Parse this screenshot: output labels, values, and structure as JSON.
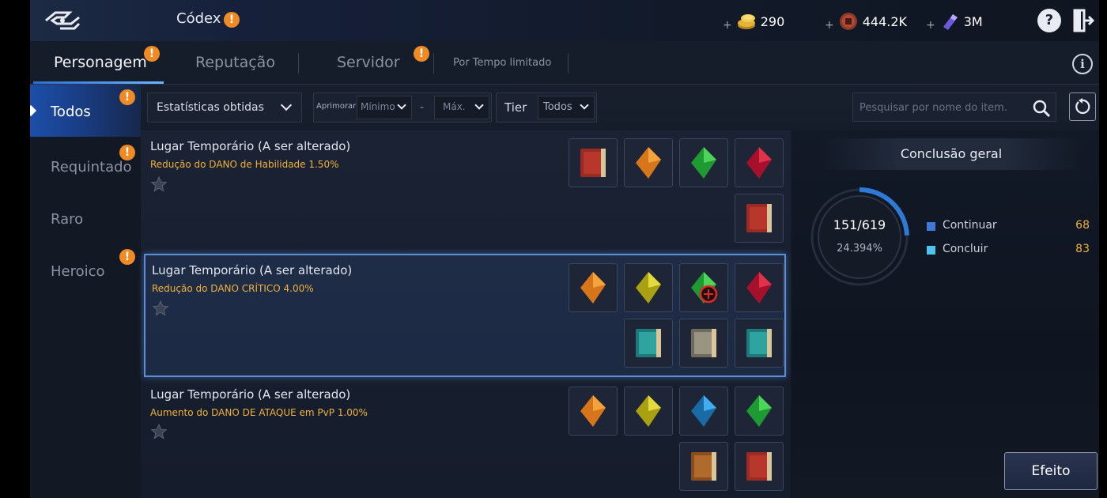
{
  "header": {
    "title": "Códex",
    "currencies": [
      {
        "icon": "gold-coins-icon",
        "value": "290"
      },
      {
        "icon": "copper-coin-icon",
        "value": "444.2K"
      },
      {
        "icon": "crystal-icon",
        "value": "3M"
      }
    ],
    "help_label": "?"
  },
  "tabs": [
    {
      "label": "Personagem",
      "active": true,
      "alert": true
    },
    {
      "label": "Reputação",
      "active": false,
      "alert": false
    },
    {
      "label": "Servidor",
      "active": false,
      "alert": true
    },
    {
      "label": "Por Tempo limitado",
      "active": false,
      "alert": false
    }
  ],
  "info_label": "i",
  "sidebar": {
    "items": [
      {
        "label": "Todos",
        "active": true,
        "alert": true
      },
      {
        "label": "Requintado",
        "active": false,
        "alert": true
      },
      {
        "label": "Raro",
        "active": false,
        "alert": false
      },
      {
        "label": "Heroico",
        "active": false,
        "alert": true
      }
    ]
  },
  "filters": {
    "stats_label": "Estatísticas obtidas",
    "enhance_label": "Aprimorar",
    "min_label": "Mínimo",
    "dash": "-",
    "max_label": "Máx.",
    "tier_label": "Tier",
    "tier_value": "Todos",
    "search_placeholder": "Pesquisar por nome do item."
  },
  "entries": [
    {
      "title": "Lugar Temporário (A ser alterado)",
      "stat": "Redução do DANO de Habilidade 1.50%",
      "selected": false,
      "items": [
        "red-book-icon",
        "orange-crystal-icon",
        "green-crystal-icon",
        "red-crystal-icon",
        "red-book-icon"
      ]
    },
    {
      "title": "Lugar Temporário (A ser alterado)",
      "stat": "Redução do DANO CRÍTICO 4.00%",
      "selected": true,
      "items": [
        "orange-crystal-icon",
        "yellow-crystal-icon",
        "green-crystal-locked-icon",
        "red-crystal-icon",
        "teal-book-icon",
        "grey-book-icon",
        "teal-book-icon"
      ]
    },
    {
      "title": "Lugar Temporário (A ser alterado)",
      "stat": "Aumento do DANO DE ATAQUE em PvP 1.00%",
      "selected": false,
      "items": [
        "orange-crystal-icon",
        "yellow-crystal-icon",
        "blue-crystal-icon",
        "green-crystal-icon",
        "brown-book-icon",
        "red-book-icon"
      ]
    }
  ],
  "completion": {
    "title": "Conclusão geral",
    "value": "151/619",
    "percent": "24.394%",
    "progress": 0.24394,
    "legend": [
      {
        "label": "Continuar",
        "value": "68",
        "color": "#3d7ad6"
      },
      {
        "label": "Concluir",
        "value": "83",
        "color": "#4fc3f0"
      }
    ]
  },
  "effect_button": "Efeito"
}
